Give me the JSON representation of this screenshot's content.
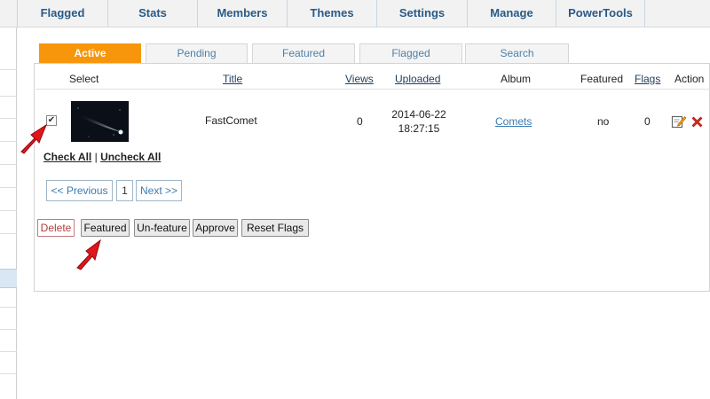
{
  "topnav": {
    "items": [
      "Flagged",
      "Stats",
      "Members",
      "Themes",
      "Settings",
      "Manage",
      "PowerTools"
    ]
  },
  "tabs": [
    "Active",
    "Pending",
    "Featured",
    "Flagged",
    "Search"
  ],
  "table": {
    "headers": {
      "select": "Select",
      "title": "Title",
      "views": "Views",
      "uploaded": "Uploaded",
      "album": "Album",
      "featured": "Featured",
      "flags": "Flags",
      "action": "Action"
    },
    "rows": [
      {
        "checked": "✔",
        "title": "FastComet",
        "views": "0",
        "uploaded_date": "2014-06-22",
        "uploaded_time": "18:27:15",
        "album": "Comets",
        "featured": "no",
        "flags": "0"
      }
    ]
  },
  "selection": {
    "check_all": "Check All",
    "separator": "|",
    "uncheck_all": "Uncheck All"
  },
  "pagination": {
    "previous": "<< Previous",
    "current": "1",
    "next": "Next >>"
  },
  "actions": {
    "delete": "Delete",
    "featured": "Featured",
    "unfeature": "Un-feature",
    "approve": "Approve",
    "reset_flags": "Reset Flags"
  },
  "colors": {
    "active_tab": "#f7960b",
    "nav_text": "#2a5a86",
    "link": "#3b7bb0",
    "delete_icon": "#d62b1f",
    "annotation_arrow": "#e0161b"
  },
  "icons": {
    "edit": "edit-icon",
    "delete": "delete-icon",
    "annotation": "red-arrow-icon"
  }
}
